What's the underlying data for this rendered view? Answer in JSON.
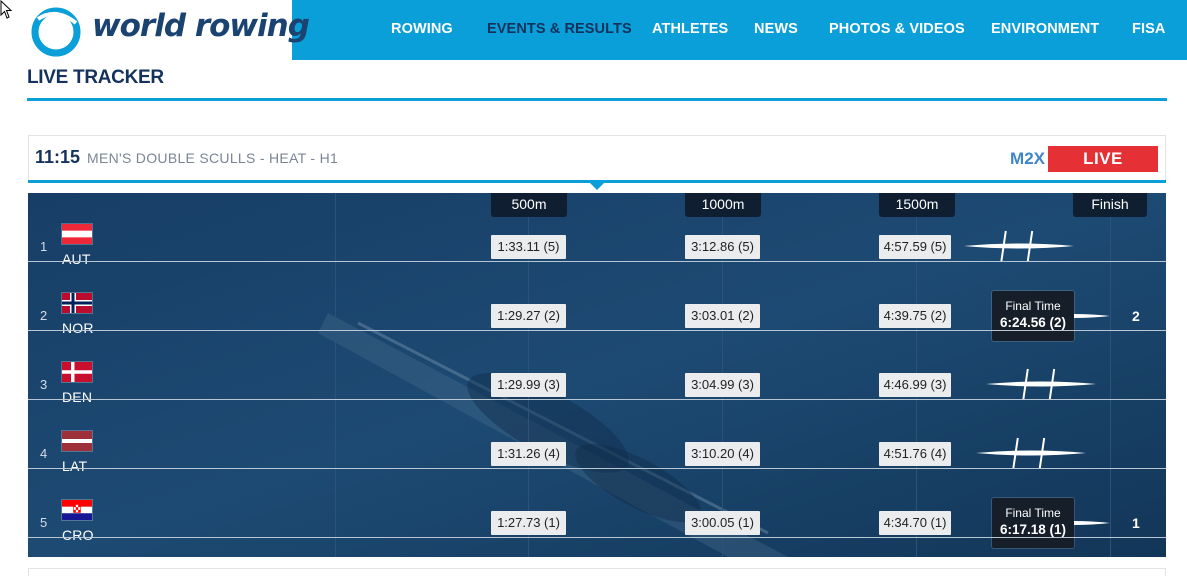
{
  "brand": {
    "name": "world rowing"
  },
  "nav": [
    {
      "label": "ROWING",
      "active": false
    },
    {
      "label": "EVENTS & RESULTS",
      "active": true
    },
    {
      "label": "ATHLETES",
      "active": false
    },
    {
      "label": "NEWS",
      "active": false
    },
    {
      "label": "PHOTOS & VIDEOS",
      "active": false
    },
    {
      "label": "ENVIRONMENT",
      "active": false
    },
    {
      "label": "FISA",
      "active": false
    }
  ],
  "page": {
    "title": "LIVE TRACKER"
  },
  "race": {
    "time": "11:15",
    "name": "MEN'S DOUBLE SCULLS - HEAT - H1",
    "boat_class": "M2X",
    "status": "LIVE"
  },
  "tracker": {
    "markers": [
      "500m",
      "1000m",
      "1500m",
      "Finish"
    ],
    "lanes": [
      {
        "lane": "1",
        "country": "AUT",
        "flag": "at",
        "splits": [
          "1:33.11 (5)",
          "3:12.86 (5)",
          "4:57.59 (5)"
        ],
        "finished": false,
        "final_label": "",
        "final_time": "",
        "place": ""
      },
      {
        "lane": "2",
        "country": "NOR",
        "flag": "no",
        "splits": [
          "1:29.27 (2)",
          "3:03.01 (2)",
          "4:39.75 (2)"
        ],
        "finished": true,
        "final_label": "Final Time",
        "final_time": "6:24.56 (2)",
        "place": "2"
      },
      {
        "lane": "3",
        "country": "DEN",
        "flag": "dk",
        "splits": [
          "1:29.99 (3)",
          "3:04.99 (3)",
          "4:46.99 (3)"
        ],
        "finished": false,
        "final_label": "",
        "final_time": "",
        "place": ""
      },
      {
        "lane": "4",
        "country": "LAT",
        "flag": "lv",
        "splits": [
          "1:31.26 (4)",
          "3:10.20 (4)",
          "4:51.76 (4)"
        ],
        "finished": false,
        "final_label": "",
        "final_time": "",
        "place": ""
      },
      {
        "lane": "5",
        "country": "CRO",
        "flag": "hr",
        "splits": [
          "1:27.73 (1)",
          "3:00.05 (1)",
          "4:34.70 (1)"
        ],
        "finished": true,
        "final_label": "Final Time",
        "final_time": "6:17.18 (1)",
        "place": "1"
      }
    ]
  },
  "colors": {
    "header_blue": "#0a9fd8",
    "navy": "#15325c",
    "live_red": "#e53135",
    "tracker_bg": "#163b62",
    "class_blue": "#3f86c8"
  },
  "icons": [
    "world-rowing-logo-icon",
    "mouse-cursor-icon",
    "boat-icon",
    "flag-icon"
  ]
}
